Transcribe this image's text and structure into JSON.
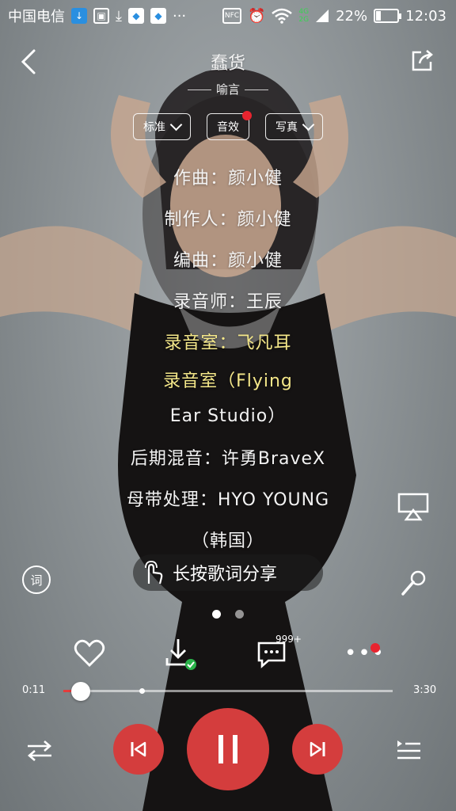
{
  "status_bar": {
    "carrier": "中国电信",
    "network_4g": "4G",
    "network_2g": "2G",
    "nfc": "NFC",
    "battery": "22%",
    "battery_level": 0.22,
    "time": "12:03",
    "icons": [
      "download-icon",
      "image-icon",
      "download-arrow-icon",
      "baidu-paw-icon",
      "baidu-paw-icon",
      "more-dots-icon",
      "nfc-icon",
      "alarm-icon",
      "wifi-icon",
      "signal-icon",
      "battery-icon"
    ]
  },
  "header": {
    "title": "蠢货",
    "artist": "喻言"
  },
  "chips": [
    {
      "label": "标准",
      "has_chevron": true,
      "has_dot": false
    },
    {
      "label": "音效",
      "has_chevron": false,
      "has_dot": true
    },
    {
      "label": "写真",
      "has_chevron": true,
      "has_dot": false
    }
  ],
  "lyrics": [
    "作曲：颜小健",
    "制作人：颜小健",
    "编曲：颜小健",
    "录音师：王辰",
    "录音室：飞凡耳",
    "录音室（Flying",
    "Ear Studio）",
    "后期混音：许勇BraveX",
    "母带处理：HYO YOUNG",
    "（韩国）"
  ],
  "lyrics_highlight": [
    4,
    5
  ],
  "share_hint": "长按歌词分享",
  "lyric_icon_label": "词",
  "actions": {
    "comment_badge": "999+"
  },
  "progress": {
    "current": "0:11",
    "total": "3:30",
    "played_fraction": 0.052,
    "buffered_fraction": 0.23
  },
  "pager": {
    "pages": 2,
    "active": 0
  },
  "colors": {
    "accent": "#d43d3d",
    "highlight_lyric": "#f4e789",
    "badge_red": "#e8242f",
    "background": "#8e9497"
  }
}
